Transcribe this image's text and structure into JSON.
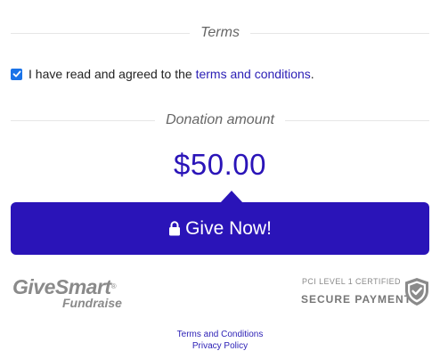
{
  "terms_section": {
    "heading": "Terms",
    "agreement_prefix": "I have read and agreed to the ",
    "agreement_link": "terms and conditions",
    "agreement_suffix": ".",
    "checked": true
  },
  "donation_section": {
    "heading": "Donation amount",
    "amount": "$50.00"
  },
  "give_button": {
    "label": "Give Now!",
    "icon": "lock-icon"
  },
  "givesmart_logo": {
    "main": "GiveSmart",
    "sub": "Fundraise"
  },
  "pci_badge": {
    "line1": "PCI LEVEL 1 CERTIFIED",
    "line2": "SECURE PAYMENT",
    "icon": "shield-check-icon"
  },
  "footer": {
    "terms_link": "Terms and Conditions",
    "privacy_link": "Privacy Policy"
  },
  "colors": {
    "accent": "#2a14b8",
    "link": "#2a1eb5",
    "checkbox": "#1a73e8",
    "muted": "#8a8a8a"
  }
}
